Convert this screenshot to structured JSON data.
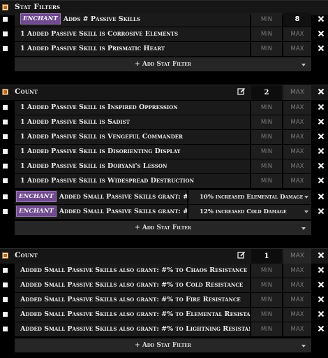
{
  "groups": [
    {
      "title": "Stat Filters",
      "rows": [
        {
          "badge": "ENCHANT",
          "label": "Adds # Passive Skills",
          "min": "MIN",
          "max": "8"
        },
        {
          "label": "1 Added Passive Skill is Corrosive Elements",
          "min": "MIN",
          "max": "MAX"
        },
        {
          "label": "1 Added Passive Skill is Prismatic Heart",
          "min": "MIN",
          "max": "MAX"
        }
      ],
      "add_label": "+ Add Stat Filter"
    },
    {
      "title": "Count",
      "count_value": "2",
      "max_placeholder": "MAX",
      "rows": [
        {
          "label": "1 Added Passive Skill is Inspired Oppression",
          "min": "MIN",
          "max": "MAX"
        },
        {
          "label": "1 Added Passive Skill is Sadist",
          "min": "MIN",
          "max": "MAX"
        },
        {
          "label": "1 Added Passive Skill is Vengeful Commander",
          "min": "MIN",
          "max": "MAX"
        },
        {
          "label": "1 Added Passive Skill is Disorienting Display",
          "min": "MIN",
          "max": "MAX"
        },
        {
          "label": "1 Added Passive Skill is Doryani's Lesson",
          "min": "MIN",
          "max": "MAX"
        },
        {
          "label": "1 Added Passive Skill is Widespread Destruction",
          "min": "MIN",
          "max": "MAX"
        },
        {
          "badge": "ENCHANT",
          "label": "Added Small Passive Skills grant: #",
          "option": "10% increased Elemental Damage"
        },
        {
          "badge": "ENCHANT",
          "label": "Added Small Passive Skills grant: #",
          "option": "12% increased Cold Damage"
        }
      ],
      "add_label": "+ Add Stat Filter"
    },
    {
      "title": "Count",
      "count_value": "1",
      "max_placeholder": "MAX",
      "rows": [
        {
          "label": "Added Small Passive Skills also grant: #% to Chaos Resistance",
          "min": "MIN",
          "max": "MAX"
        },
        {
          "label": "Added Small Passive Skills also grant: #% to Cold Resistance",
          "min": "MIN",
          "max": "MAX"
        },
        {
          "label": "Added Small Passive Skills also grant: #% to Fire Resistance",
          "min": "MIN",
          "max": "MAX"
        },
        {
          "label": "Added Small Passive Skills also grant: #% to Elemental Resistance",
          "min": "MIN",
          "max": "MAX"
        },
        {
          "label": "Added Small Passive Skills also grant: #% to Lightning Resistance",
          "min": "MIN",
          "max": "MAX"
        }
      ],
      "add_label": "+ Add Stat Filter"
    }
  ],
  "icons": {
    "group_toggle": "checkbox-icon",
    "row_toggle": "checkbox-icon",
    "remove": "close-icon",
    "edit": "edit-icon",
    "dropdown": "chevron-down-icon"
  },
  "colors": {
    "background": "#000000",
    "enchant_badge": "#6f4a8e",
    "header_checkbox": "#b36a1a"
  }
}
